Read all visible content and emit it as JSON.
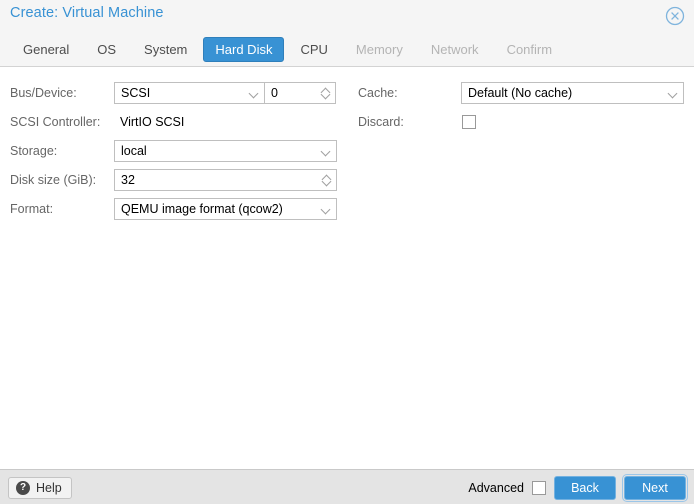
{
  "window": {
    "title": "Create: Virtual Machine",
    "close_icon": "close-circle-icon",
    "accent_color": "#3892d4",
    "title_color": "#3892d4",
    "header_bg": "#f5f5f5",
    "footer_bg": "#e4e4e4"
  },
  "tabs": [
    {
      "label": "General",
      "active": false,
      "disabled": false
    },
    {
      "label": "OS",
      "active": false,
      "disabled": false
    },
    {
      "label": "System",
      "active": false,
      "disabled": false
    },
    {
      "label": "Hard Disk",
      "active": true,
      "disabled": false
    },
    {
      "label": "CPU",
      "active": false,
      "disabled": false
    },
    {
      "label": "Memory",
      "active": false,
      "disabled": true
    },
    {
      "label": "Network",
      "active": false,
      "disabled": true
    },
    {
      "label": "Confirm",
      "active": false,
      "disabled": true
    }
  ],
  "form": {
    "left": {
      "bus_device": {
        "label": "Bus/Device:",
        "bus_value": "SCSI",
        "device_value": "0"
      },
      "scsi_controller": {
        "label": "SCSI Controller:",
        "value": "VirtIO SCSI"
      },
      "storage": {
        "label": "Storage:",
        "value": "local"
      },
      "disk_size": {
        "label": "Disk size (GiB):",
        "value": "32"
      },
      "format": {
        "label": "Format:",
        "value": "QEMU image format (qcow2)"
      }
    },
    "right": {
      "cache": {
        "label": "Cache:",
        "value": "Default (No cache)"
      },
      "discard": {
        "label": "Discard:",
        "checked": false
      }
    }
  },
  "footer": {
    "help_label": "Help",
    "help_icon": "question-mark-icon",
    "advanced_label": "Advanced",
    "advanced_checked": false,
    "back_label": "Back",
    "next_label": "Next"
  }
}
